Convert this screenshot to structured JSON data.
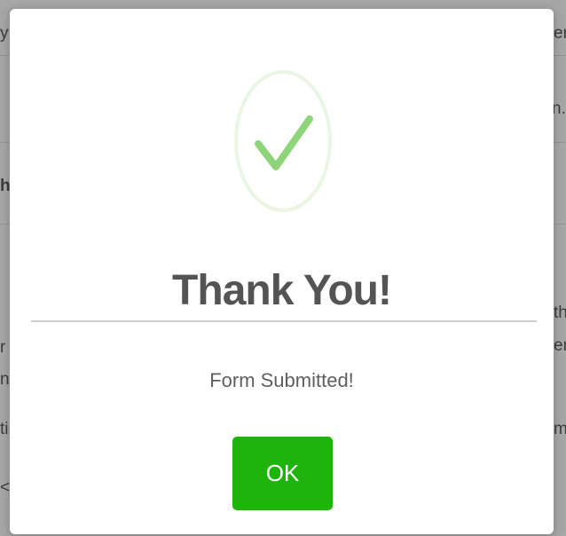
{
  "background": {
    "fragments": [
      {
        "id": "frag-1",
        "text": "y"
      },
      {
        "id": "frag-2",
        "text": "er"
      },
      {
        "id": "frag-3",
        "text": "n."
      },
      {
        "id": "frag-4",
        "text": "h"
      },
      {
        "id": "frag-5",
        "text": "th"
      },
      {
        "id": "frag-6",
        "text": "r"
      },
      {
        "id": "frag-7",
        "text": "er"
      },
      {
        "id": "frag-8",
        "text": "n"
      },
      {
        "id": "frag-9",
        "text": "ti"
      },
      {
        "id": "frag-10",
        "text": "m"
      },
      {
        "id": "frag-11",
        "text": "<"
      }
    ]
  },
  "modal": {
    "icon": "success-check-icon",
    "title": "Thank You!",
    "message": "Form Submitted!",
    "ok_label": "OK"
  },
  "colors": {
    "check_stroke": "#8ed57a",
    "ring": "#eaf5e4",
    "ok_button": "#1fb40c",
    "title": "#545454"
  }
}
